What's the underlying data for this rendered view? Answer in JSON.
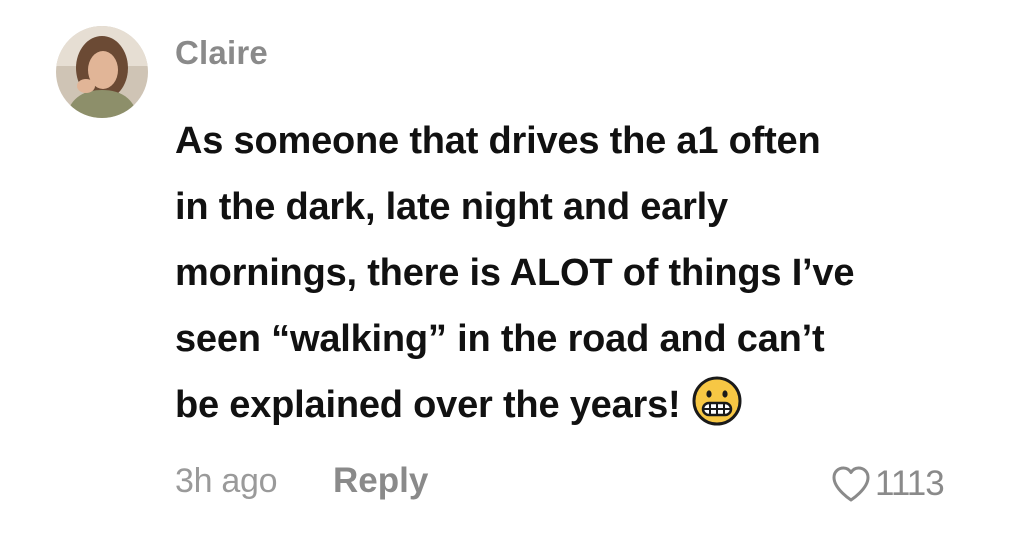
{
  "comment": {
    "username": "Claire",
    "text_lines": [
      "As someone that drives the a1 often",
      "in the dark, late night and early",
      "mornings, there is ALOT of things I’ve",
      "seen “walking” in the road and can’t",
      "be explained over the years!"
    ],
    "emoji": "grimacing-face-icon",
    "time": "3h ago",
    "reply_label": "Reply",
    "like_count": "1113"
  },
  "colors": {
    "username": "#8a8a8a",
    "text": "#111111",
    "meta": "#9a9a9a",
    "emoji_face": "#f7c744"
  }
}
